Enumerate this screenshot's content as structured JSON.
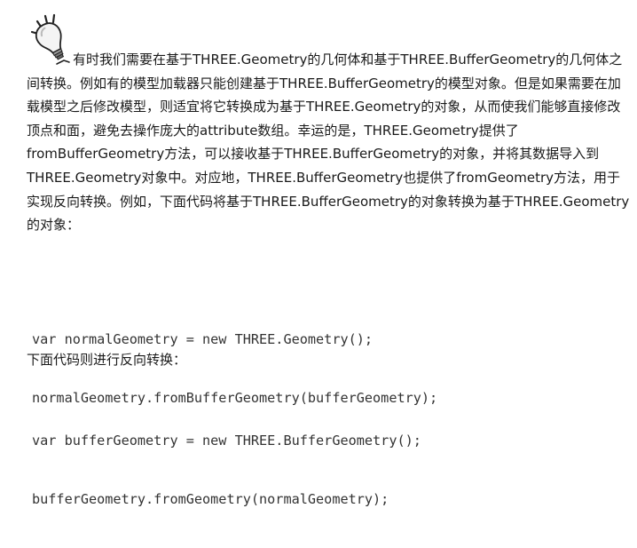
{
  "tip": {
    "icon": "lightbulb-icon"
  },
  "intro_paragraph": "有时我们需要在基于THREE.Geometry的几何体和基于THREE.BufferGeometry的几何体之间转换。例如有的模型加载器只能创建基于THREE.BufferGeometry的模型对象。但是如果需要在加载模型之后修改模型，则适宜将它转换成为基于THREE.Geometry的对象，从而使我们能够直接修改顶点和面，避免去操作庞大的attribute数组。幸运的是，THREE.Geometry提供了fromBufferGeometry方法，可以接收基于THREE.BufferGeometry的对象，并将其数据导入到THREE.Geometry对象中。对应地，THREE.BufferGeometry也提供了fromGeometry方法，用于实现反向转换。例如，下面代码将基于THREE.BufferGeometry的对象转换为基于THREE.Geometry的对象：",
  "code_block_1": {
    "lines": [
      "var normalGeometry = new THREE.Geometry();",
      "normalGeometry.fromBufferGeometry(bufferGeometry);"
    ]
  },
  "reverse_label": "下面代码则进行反向转换：",
  "code_block_2": {
    "lines": [
      "var bufferGeometry = new THREE.BufferGeometry();",
      "bufferGeometry.fromGeometry(normalGeometry);"
    ]
  }
}
